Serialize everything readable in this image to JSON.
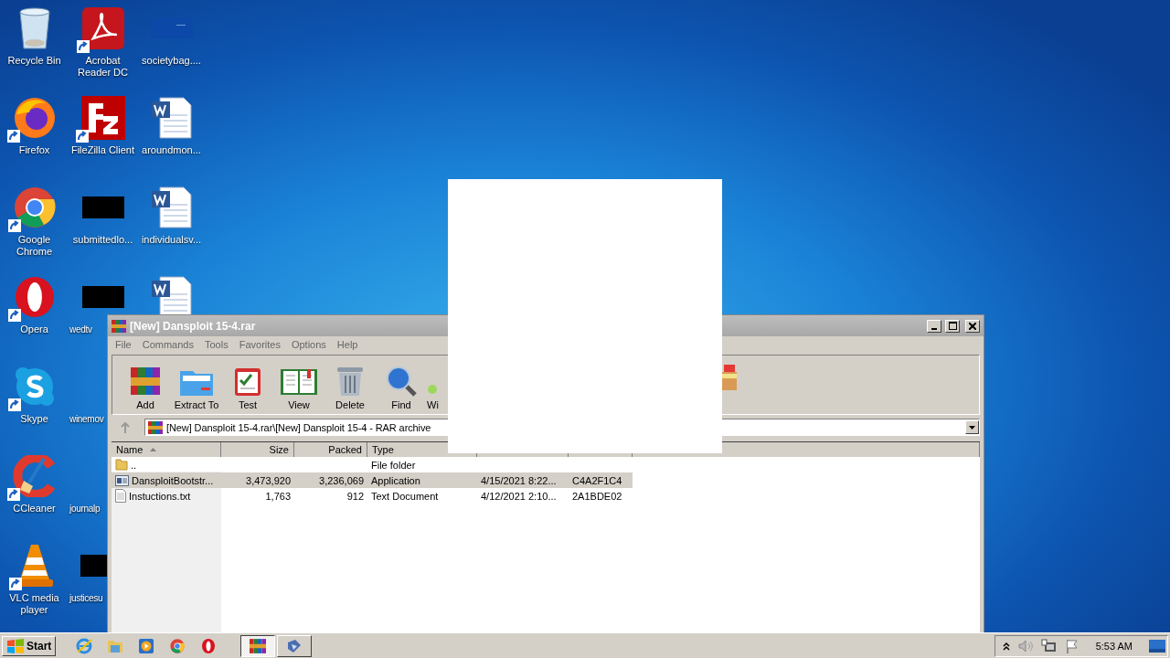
{
  "desktop": {
    "icons": [
      {
        "label": "Recycle Bin",
        "kind": "recycle",
        "shortcut": false
      },
      {
        "label": "Firefox",
        "kind": "firefox",
        "shortcut": true
      },
      {
        "label": "Google Chrome",
        "kind": "chrome",
        "shortcut": true
      },
      {
        "label": "Opera",
        "kind": "opera",
        "shortcut": true
      },
      {
        "label": "Skype",
        "kind": "skype",
        "shortcut": true
      },
      {
        "label": "CCleaner",
        "kind": "ccleaner",
        "shortcut": true
      },
      {
        "label": "VLC media player",
        "kind": "vlc",
        "shortcut": true
      },
      {
        "label": "Acrobat Reader DC",
        "kind": "acrobat",
        "shortcut": true
      },
      {
        "label": "FileZilla Client",
        "kind": "filezilla",
        "shortcut": true
      },
      {
        "label": "submittedlo...",
        "kind": "thumb",
        "shortcut": false
      },
      {
        "label": "wedtv",
        "kind": "thumb",
        "shortcut": false
      },
      {
        "label": "winemov",
        "kind": "blank",
        "shortcut": false
      },
      {
        "label": "journalp",
        "kind": "blank",
        "shortcut": false
      },
      {
        "label": "justicesu",
        "kind": "thumb-small",
        "shortcut": false
      },
      {
        "label": "societybag....",
        "kind": "dark",
        "shortcut": false
      },
      {
        "label": "aroundmon...",
        "kind": "word",
        "shortcut": false
      },
      {
        "label": "individualsv...",
        "kind": "word",
        "shortcut": false
      },
      {
        "kind": "word",
        "shortcut": false
      }
    ]
  },
  "window": {
    "title": "[New] Dansploit 15-4.rar",
    "menu": [
      "File",
      "Commands",
      "Tools",
      "Favorites",
      "Options",
      "Help"
    ],
    "toolbar": [
      {
        "label": "Add",
        "kind": "add"
      },
      {
        "label": "Extract To",
        "kind": "extract"
      },
      {
        "label": "Test",
        "kind": "test"
      },
      {
        "label": "View",
        "kind": "view"
      },
      {
        "label": "Delete",
        "kind": "delete"
      },
      {
        "label": "Find",
        "kind": "find"
      },
      {
        "label": "Wi",
        "kind": "wizard"
      },
      {
        "kind": "sfx"
      }
    ],
    "address": "[New] Dansploit 15-4.rar\\[New] Dansploit 15-4 - RAR archive",
    "columns": [
      {
        "label": "Name",
        "sorted": true
      },
      {
        "label": "Size",
        "sorted": false
      },
      {
        "label": "Packed",
        "sorted": false
      },
      {
        "label": "Type",
        "sorted": false
      }
    ],
    "rows": [
      {
        "kind": "folder",
        "name": "..",
        "type": "File folder",
        "selected": false
      },
      {
        "kind": "app",
        "name": "DansploitBootstr...",
        "size": "3,473,920",
        "packed": "3,236,069",
        "type": "Application",
        "modified": "4/15/2021 8:22...",
        "crc": "C4A2F1C4",
        "selected": true
      },
      {
        "kind": "text",
        "name": "Instuctions.txt",
        "size": "1,763",
        "packed": "912",
        "type": "Text Document",
        "modified": "4/12/2021 2:10...",
        "crc": "2A1BDE02",
        "selected": false
      }
    ]
  },
  "taskbar": {
    "start": "Start",
    "items": [
      {
        "kind": "ie",
        "selected": false
      },
      {
        "kind": "explorer",
        "selected": false
      },
      {
        "kind": "media",
        "selected": false
      },
      {
        "kind": "chrome",
        "selected": false
      },
      {
        "kind": "opera",
        "selected": false
      },
      {
        "kind": "winrar",
        "selected": true
      },
      {
        "kind": "app",
        "selected": false
      }
    ],
    "tray": {
      "time": "5:53 AM"
    }
  }
}
